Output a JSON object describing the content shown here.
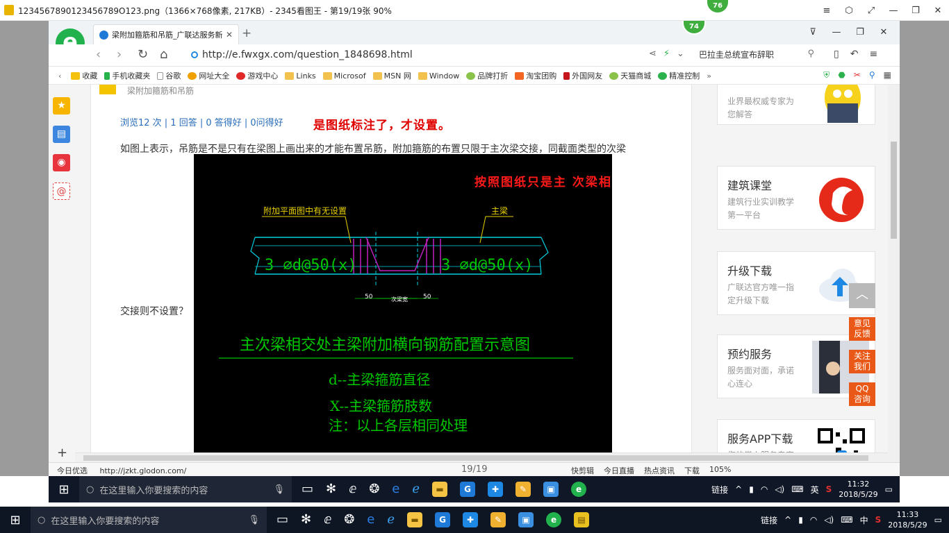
{
  "viewer": {
    "title": "1234567890123456789O123.png（1366×768像素, 217KB）- 2345看图王 - 第19/19张 90%",
    "badge_outer": "76",
    "badge_inner": "74",
    "controls": [
      "≡",
      "⬡",
      "⤢",
      "—",
      "❐",
      "✕"
    ]
  },
  "browser": {
    "logo": "e",
    "tab_title": "梁附加箍筋和吊筋_广联达服务新",
    "tab_close": "✕",
    "new_tab": "+",
    "window_controls": [
      "⊽",
      "—",
      "❐",
      "✕"
    ],
    "url": "http://e.fwxgx.com/question_1848698.html",
    "search_text": "巴拉圭总统宣布辞职",
    "bookmarks": [
      "收藏",
      "手机收藏夹",
      "谷歌",
      "网址大全",
      "游戏中心",
      "Links",
      "Microsof",
      "MSN 网",
      "Window",
      "品牌打折",
      "淘宝团购",
      "外国网友",
      "天猫商城",
      "精准控制"
    ],
    "bookmarks_more": "»",
    "nav_back": "‹"
  },
  "page": {
    "question_header": "梁附加箍筋和吊筋",
    "stats": "浏览12 次 | 1 回答 | 0 答得好 | 0问得好",
    "red_annotation": "是图纸标注了，才设置。",
    "question_text": "如图上表示，吊筋是不是只有在梁图上画出来的才能布置吊筋，附加箍筋的布置只限于主次梁交接，同截面类型的次梁",
    "question_text2": "交接则不设置？",
    "cad": {
      "red_annotation": "按照图纸只是主 次梁相交增加",
      "label_left": "附加平面图中有无设置",
      "label_right": "主梁",
      "rebar_left": "3 ⌀d@50(x)",
      "rebar_right": "3 ⌀d@50(x)",
      "dim_left": "50",
      "dim_mid": "次梁宽",
      "dim_right": "50",
      "diagram_title": "主次梁相交处主梁附加横向钢筋配置示意图",
      "note1": "d--主梁箍筋直径",
      "note2": "X--主梁箍筋肢数",
      "note3": "注：以上各层相同处理"
    }
  },
  "sidebar_cards": [
    {
      "title": "",
      "sub": "业界最权威专家为您解答"
    },
    {
      "title": "建筑课堂",
      "sub": "建筑行业实训教学第一平台"
    },
    {
      "title": "升级下载",
      "sub": "广联达官方唯一指定升级下载"
    },
    {
      "title": "预约服务",
      "sub": "服务面对面，承诺心连心"
    },
    {
      "title": "服务APP下载",
      "sub": "您的掌上服务专家"
    }
  ],
  "float_buttons": {
    "top": "︿",
    "feedback": "意见\n反馈",
    "follow": "关注\n我们",
    "qq": "QQ\n咨询"
  },
  "status": {
    "left": "今日优选",
    "url": "http://jzkt.glodon.com/",
    "counter": "19/19",
    "items": [
      "快剪辑",
      "今日直播",
      "热点资讯",
      "下载",
      "105%"
    ]
  },
  "taskbar_inner": {
    "search": "在这里输入你要搜索的内容",
    "tray_text": "链接",
    "ime": "英",
    "time": "11:32",
    "date": "2018/5/29"
  },
  "taskbar_outer": {
    "search": "在这里输入你要搜索的内容",
    "tray_text": "链接",
    "ime": "中",
    "time": "11:33",
    "date": "2018/5/29"
  },
  "colors": {
    "accent_green": "#21b24d",
    "annotation_red": "#e00000",
    "cad_green": "#00c800",
    "cad_cyan": "#00d0e0",
    "cad_magenta": "#c020c0",
    "cad_yellow": "#e8d000",
    "float_orange": "#e95816"
  }
}
